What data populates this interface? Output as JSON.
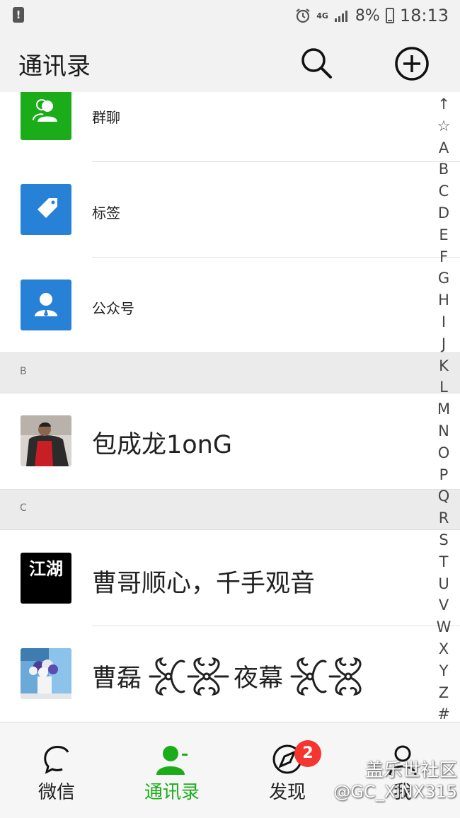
{
  "status_bar": {
    "network": "4G",
    "battery_percent": "8%",
    "time": "18:13",
    "icons": [
      "alert-icon",
      "alarm-clock-icon",
      "signal-icon",
      "battery-icon"
    ]
  },
  "header": {
    "title": "通讯录",
    "icons": [
      "search-icon",
      "add-circle-icon"
    ]
  },
  "functions": [
    {
      "label": "群聊",
      "icon": "group-icon",
      "color": "#1aad19"
    },
    {
      "label": "标签",
      "icon": "tag-icon",
      "color": "#2782d7"
    },
    {
      "label": "公众号",
      "icon": "person-icon",
      "color": "#2782d7"
    }
  ],
  "sections": [
    {
      "letter": "B",
      "contacts": [
        {
          "name": "包成龙1onG"
        }
      ]
    },
    {
      "letter": "C",
      "contacts": [
        {
          "name": "曹哥顺心，千手观音"
        },
        {
          "name": "曹磊",
          "name_suffix": "夜幕"
        }
      ]
    }
  ],
  "avatar_text": "江湖",
  "alphabet_index": [
    "↑",
    "☆",
    "A",
    "B",
    "C",
    "D",
    "E",
    "F",
    "G",
    "H",
    "I",
    "J",
    "K",
    "L",
    "M",
    "N",
    "O",
    "P",
    "Q",
    "R",
    "S",
    "T",
    "U",
    "V",
    "W",
    "X",
    "Y",
    "Z",
    "#"
  ],
  "tabs": [
    {
      "label": "微信",
      "icon": "chat-icon",
      "active": false
    },
    {
      "label": "通讯录",
      "icon": "contacts-icon",
      "active": true
    },
    {
      "label": "发现",
      "icon": "discover-icon",
      "active": false,
      "badge": "2"
    },
    {
      "label": "我",
      "icon": "me-icon",
      "active": false
    }
  ],
  "watermark": {
    "line1": "盖乐世社区",
    "line2": "@GC_XiNX315"
  },
  "colors": {
    "accent_green": "#1aad19",
    "accent_blue": "#2782d7",
    "badge_red": "#f43530"
  }
}
